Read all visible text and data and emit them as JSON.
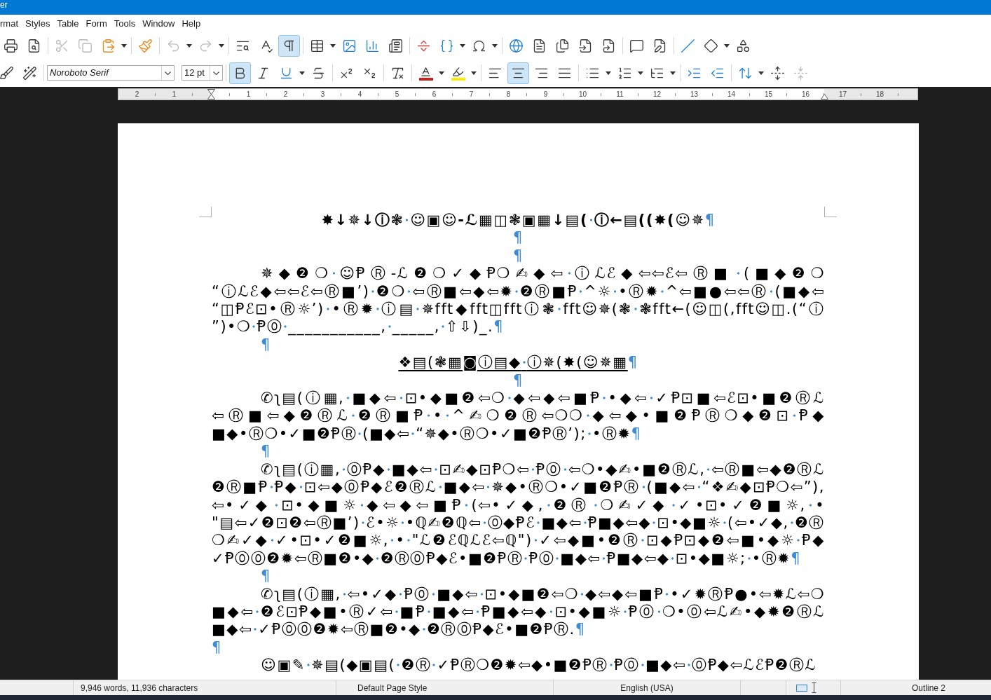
{
  "window": {
    "title": "er"
  },
  "menu_bar": [
    "rmat",
    "Styles",
    "Table",
    "Form",
    "Tools",
    "Window",
    "Help"
  ],
  "standard_toolbar": [
    [
      {
        "kind": "print",
        "on": false,
        "disabled": false,
        "menu": false
      },
      {
        "kind": "print_preview",
        "on": false,
        "disabled": false,
        "menu": false
      }
    ],
    [
      {
        "kind": "cut",
        "on": false,
        "disabled": true,
        "menu": false
      },
      {
        "kind": "copy",
        "on": false,
        "disabled": true,
        "menu": false
      },
      {
        "kind": "paste",
        "on": false,
        "disabled": false,
        "menu": true
      }
    ],
    [
      {
        "kind": "clone_formatting",
        "on": false,
        "disabled": false,
        "menu": false
      }
    ],
    [
      {
        "kind": "undo",
        "on": false,
        "disabled": true,
        "menu": true
      },
      {
        "kind": "redo",
        "on": false,
        "disabled": true,
        "menu": true
      }
    ],
    [
      {
        "kind": "find_replace",
        "on": false,
        "disabled": false,
        "menu": false
      },
      {
        "kind": "spelling",
        "on": false,
        "disabled": false,
        "menu": false
      },
      {
        "kind": "formatting_marks",
        "on": true,
        "disabled": false,
        "menu": false
      }
    ],
    [
      {
        "kind": "table",
        "on": false,
        "disabled": false,
        "menu": true
      },
      {
        "kind": "image",
        "on": false,
        "disabled": false,
        "menu": false
      },
      {
        "kind": "chart",
        "on": false,
        "disabled": false,
        "menu": false
      },
      {
        "kind": "text_box",
        "on": false,
        "disabled": false,
        "menu": false
      }
    ],
    [
      {
        "kind": "page_break",
        "on": false,
        "disabled": false,
        "menu": false
      },
      {
        "kind": "field",
        "on": false,
        "disabled": false,
        "menu": true
      },
      {
        "kind": "special_character",
        "on": false,
        "disabled": false,
        "menu": true
      }
    ],
    [
      {
        "kind": "hyperlink",
        "on": false,
        "disabled": false,
        "menu": false
      },
      {
        "kind": "footnote",
        "on": false,
        "disabled": false,
        "menu": false
      },
      {
        "kind": "index",
        "on": false,
        "disabled": false,
        "menu": false
      },
      {
        "kind": "bookmark",
        "on": false,
        "disabled": false,
        "menu": false
      },
      {
        "kind": "cross_reference",
        "on": false,
        "disabled": false,
        "menu": false
      }
    ],
    [
      {
        "kind": "comment",
        "on": false,
        "disabled": false,
        "menu": false
      },
      {
        "kind": "track_changes",
        "on": false,
        "disabled": false,
        "menu": false
      }
    ],
    [
      {
        "kind": "line",
        "on": false,
        "disabled": false,
        "menu": false
      },
      {
        "kind": "basic_shapes",
        "on": false,
        "disabled": false,
        "menu": true
      },
      {
        "kind": "shapes",
        "on": false,
        "disabled": false,
        "menu": false
      }
    ]
  ],
  "formatting_toolbar": {
    "style_buttons": [
      {
        "kind": "update_style",
        "on": false,
        "disabled": false,
        "menu": false
      },
      {
        "kind": "new_style",
        "on": false,
        "disabled": false,
        "menu": false
      }
    ],
    "font_name": "Noroboto Serif",
    "font_size": "12 pt",
    "groups": [
      [
        {
          "kind": "bold",
          "on": true,
          "disabled": false,
          "menu": false
        },
        {
          "kind": "italic",
          "on": false,
          "disabled": false,
          "menu": false
        },
        {
          "kind": "underline",
          "on": false,
          "disabled": false,
          "menu": true
        },
        {
          "kind": "strikethrough",
          "on": false,
          "disabled": false,
          "menu": false
        }
      ],
      [
        {
          "kind": "superscript",
          "on": false,
          "disabled": false,
          "menu": false
        },
        {
          "kind": "subscript",
          "on": false,
          "disabled": false,
          "menu": false
        }
      ],
      [
        {
          "kind": "clear_formatting",
          "on": false,
          "disabled": false,
          "menu": false
        }
      ],
      [
        {
          "kind": "font_color",
          "on": false,
          "disabled": false,
          "menu": true
        },
        {
          "kind": "highlight",
          "on": false,
          "disabled": false,
          "menu": true
        }
      ],
      [
        {
          "kind": "align_left",
          "on": false,
          "disabled": false,
          "menu": false
        },
        {
          "kind": "align_center",
          "on": true,
          "disabled": false,
          "menu": false
        },
        {
          "kind": "align_right",
          "on": false,
          "disabled": false,
          "menu": false
        },
        {
          "kind": "justify",
          "on": false,
          "disabled": false,
          "menu": false
        }
      ],
      [
        {
          "kind": "bullets",
          "on": false,
          "disabled": false,
          "menu": true
        },
        {
          "kind": "numbering",
          "on": false,
          "disabled": false,
          "menu": true
        },
        {
          "kind": "outline",
          "on": false,
          "disabled": false,
          "menu": true
        }
      ],
      [
        {
          "kind": "indent_increase",
          "on": false,
          "disabled": false,
          "menu": false
        },
        {
          "kind": "indent_decrease",
          "on": false,
          "disabled": false,
          "menu": false
        }
      ],
      [
        {
          "kind": "line_spacing",
          "on": false,
          "disabled": false,
          "menu": true
        },
        {
          "kind": "spacing_increase",
          "on": false,
          "disabled": false,
          "menu": false
        },
        {
          "kind": "spacing_decrease",
          "on": false,
          "disabled": true,
          "menu": false
        }
      ]
    ]
  },
  "ruler": {
    "left_labels": [
      "2",
      "1"
    ],
    "right_labels": [
      "1",
      "2",
      "3",
      "4",
      "5",
      "6",
      "7",
      "8",
      "9",
      "10",
      "11",
      "12",
      "13",
      "14",
      "15",
      "16",
      "17",
      "18"
    ]
  },
  "document": {
    "paragraphs": [
      {
        "kind": "title",
        "text": "✸↓✵↓ⓘ❃ ☺▣☺-ℒ▦◫❃▣▦↓▤( ⓘ←▤((✸(☺✵",
        "end_mark": "¶"
      },
      {
        "kind": "title",
        "end_mark": "¶"
      },
      {
        "kind": "title",
        "end_mark": "¶"
      },
      {
        "kind": "body",
        "text": "✵◆❷❍ ☺ⱣⓇ-ℒ❷❍✓◆Ᵽ❍✍◆⇦ ⓘℒℰ◆⇦⇦ℰ⇦Ⓡ■ (■◆❷❍ “ⓘℒℰ◆⇦⇦ℰ⇦Ⓡ■’) ❷❍ ⇦Ⓡ■⇦◆⇦✹ ❷Ⓡ■Ᵽ ^☼ •Ⓡ✹ ^⇦■●⇦⇦Ⓡ (■◆⇦ “◫Ᵽℰ⊡•Ⓡ☼’) •Ⓡ✹ ⓘ▤ ✵fft◆fft◫fftⓘ❃ fft☺✵(❃ ❃fft←(☺◫(,fft☺◫.(“ⓘ ”)•❍ Ᵽ⓪ ___________, _____, ⇧⇩)_.",
        "end_mark": "¶"
      },
      {
        "kind": "body",
        "end_mark": "¶"
      },
      {
        "kind": "heading",
        "text": "❖▤(❃▦◙ⓘ▤◆ ⓘ✵(✸(☺✵▦",
        "end_mark": "¶"
      },
      {
        "kind": "heading",
        "end_mark": "¶"
      },
      {
        "kind": "body",
        "text": "✆ʅ▤(ⓘ▦, ■◆⇦ ⊡•◆■❷⇦❍ ◆⇦◆⇦■Ᵽ •◆⇦ ✓Ᵽ⊡■⇦ℰ⊡•■❷Ⓡℒ ⇦Ⓡ■⇦◆❷Ⓡℒ ❷Ⓡ■Ᵽ • ^✍❍❷Ⓡ⇦❍❍ ◆⇦◆•■❷ⱣⓇ❍◆❷⊡ Ᵽ◆ ■◆•Ⓡ❍•✓■❷ⱣⓇ (■◆⇦ “✵◆•Ⓡ❍•✓■❷ⱣⓇ’); •Ⓡ✹",
        "end_mark": "¶"
      },
      {
        "kind": "body",
        "end_mark": "¶"
      },
      {
        "kind": "body",
        "text": "✆ʅ▤(ⓘ▦, ⓪Ᵽ◆ ■◆⇦ ⊡✍◆⊡Ᵽ❍⇦ Ᵽ⓪ ⇦❍•◆✍•■❷Ⓡℒ, ⇦Ⓡ■⇦◆❷Ⓡℒ ❷Ⓡ■Ᵽ Ᵽ◆ ⊡⇦◆⓪Ᵽ◆ℰ❷Ⓡℒ ■◆⇦ ✵◆•Ⓡ❍•✓■❷ⱣⓇ (■◆⇦ “❖✍◆⊡Ᵽ❍⇦”), ⇦•✓◆ ⊡•◆■☼ ◆⇦◆⇦■Ᵽ (⇦•✓◆, ❷Ⓡ ❍✍✓◆ ✓•⊡•✓❷■☼, • \"▤⇦✓❷⊡❷⇦Ⓡ■’) ℰ•☼ •ℚ✍❷ℚ⇦ ⓪◆Ᵽℰ ■◆⇦ Ᵽ■◆⇦◆ ⊡•◆■☼ (⇦•✓◆, ❷Ⓡ ❍✍✓◆ ✓•⊡•✓❷■☼, • \"ℒ❷ℰℚℒℰ⇦ℚ\") ✓⇦◆■•❷Ⓡ ⊡◆Ᵽ⊡◆❷⇦■•◆☼ Ᵽ◆ ✓Ᵽ⓪⓪❷✹⇦Ⓡ■❷•◆ ❷Ⓡ⓪Ᵽ◆ℰ•■❷ⱣⓇ Ᵽ⓪ ■◆⇦ Ᵽ■◆⇦◆ ⊡•◆■☼; •Ⓡ✹",
        "end_mark": "¶"
      },
      {
        "kind": "body",
        "end_mark": "¶"
      },
      {
        "kind": "body",
        "text": "✆ʅ▤(ⓘ▦, ⇦•✓◆ Ᵽ⓪ ■◆⇦ ⊡•◆■❷⇦❍ ◆⇦◆⇦■Ᵽ •✓✹ⓇⱣ●•⇦✹ℒ⇦❍ ■◆⇦ ❷ℰ⊡Ᵽ◆■•Ⓡ✓⇦ ■Ᵽ ■◆⇦ Ᵽ■◆⇦◆ ⊡•◆■☼ Ᵽ⓪ ❍•⓪⇦ℒ✍•◆✹❷Ⓡℒ ■◆⇦ ✓Ᵽ⓪⓪❷✹⇦Ⓡ■❷•◆ ❷Ⓡ⓪Ᵽ◆ℰ•■❷ⱣⓇ.",
        "end_mark": "¶"
      },
      {
        "kind": "plain",
        "end_mark": "¶"
      },
      {
        "kind": "body",
        "text": "☺▣✎ ✵▤(◆▣▤( ❷Ⓡ ✓ⱣⓇ❍❷✹⇦◆•■❷ⱣⓇ Ᵽ⓪ ■◆⇦ ⓪Ᵽ◆⇦ℒℰⱣ❷Ⓡℒ"
      }
    ]
  },
  "status_bar": {
    "word_count": "9,946 words, 11,936 characters",
    "page_style": "Default Page Style",
    "language": "English (USA)",
    "outline": "Outline 2"
  }
}
